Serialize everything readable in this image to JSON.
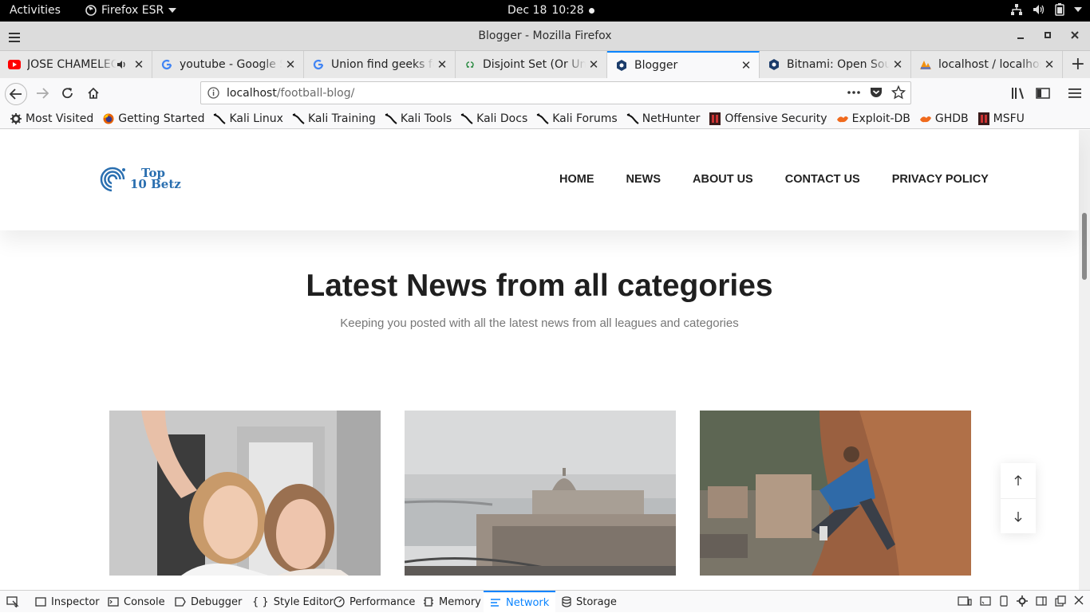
{
  "system_bar": {
    "activities": "Activities",
    "app_name": "Firefox ESR",
    "date": "Dec 18",
    "time": "10:28"
  },
  "window": {
    "title": "Blogger - Mozilla Firefox"
  },
  "tabs": [
    {
      "label": "JOSE CHAMELEO",
      "favicon": "youtube-icon"
    },
    {
      "label": "youtube - Google Se",
      "favicon": "google-icon"
    },
    {
      "label": "Union find geeks for",
      "favicon": "google-icon"
    },
    {
      "label": "Disjoint Set (Or Unio",
      "favicon": "gfg-icon"
    },
    {
      "label": "Blogger",
      "favicon": "bitnami-icon"
    },
    {
      "label": "Bitnami: Open Sour",
      "favicon": "bitnami-icon"
    },
    {
      "label": "localhost / localhost",
      "favicon": "phpmyadmin-icon"
    }
  ],
  "url": {
    "host": "localhost",
    "path": "/football-blog/"
  },
  "bookmarks": [
    {
      "label": "Most Visited",
      "icon": "gear-icon"
    },
    {
      "label": "Getting Started",
      "icon": "firefox-icon"
    },
    {
      "label": "Kali Linux",
      "icon": "kali-dragon-icon"
    },
    {
      "label": "Kali Training",
      "icon": "kali-dragon-icon"
    },
    {
      "label": "Kali Tools",
      "icon": "kali-dragon-icon"
    },
    {
      "label": "Kali Docs",
      "icon": "kali-dragon-icon"
    },
    {
      "label": "Kali Forums",
      "icon": "kali-dragon-icon"
    },
    {
      "label": "NetHunter",
      "icon": "kali-dragon-icon"
    },
    {
      "label": "Offensive Security",
      "icon": "offsec-icon"
    },
    {
      "label": "Exploit-DB",
      "icon": "exploitdb-icon"
    },
    {
      "label": "GHDB",
      "icon": "exploitdb-icon"
    },
    {
      "label": "MSFU",
      "icon": "offsec-icon"
    }
  ],
  "site": {
    "logo_line1": "Top",
    "logo_line2": "10 Betz",
    "nav": [
      "HOME",
      "NEWS",
      "ABOUT US",
      "CONTACT US",
      "PRIVACY POLICY"
    ],
    "heading": "Latest News from all categories",
    "subheading": "Keeping you posted with all the latest news from all leagues and categories",
    "cards": [
      {
        "image": "selfie-photo"
      },
      {
        "image": "city-river-photo"
      },
      {
        "image": "rock-climber-photo"
      }
    ]
  },
  "devtools": {
    "tabs": [
      "Inspector",
      "Console",
      "Debugger",
      "Style Editor",
      "Performance",
      "Memory",
      "Network",
      "Storage"
    ],
    "active": "Network"
  },
  "colors": {
    "accent": "#0a84ff",
    "logo_blue": "#2a6fb0"
  }
}
